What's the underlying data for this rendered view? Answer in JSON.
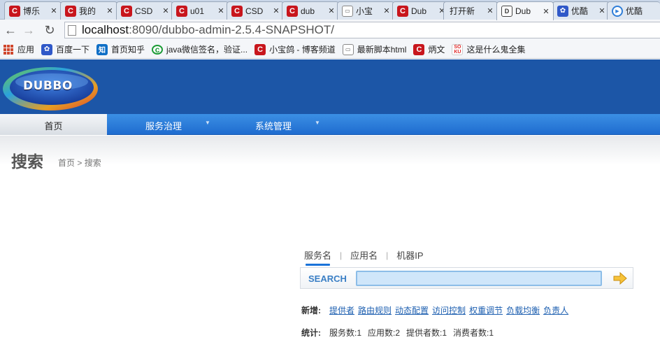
{
  "tabs": [
    {
      "title": "博乐",
      "icon": "c",
      "left": 0
    },
    {
      "title": "我的",
      "icon": "c"
    },
    {
      "title": "CSD",
      "icon": "c"
    },
    {
      "title": "u01",
      "icon": "c"
    },
    {
      "title": "CSD",
      "icon": "c"
    },
    {
      "title": "dub",
      "icon": "c"
    },
    {
      "title": "小宝",
      "icon": "doc"
    },
    {
      "title": "Dub",
      "icon": "c"
    },
    {
      "title": "打开新",
      "icon": "none"
    },
    {
      "title": "Dub",
      "icon": "dubbo"
    },
    {
      "title": "优酷",
      "icon": "paw"
    },
    {
      "title": "优酷",
      "icon": "play"
    }
  ],
  "toolbar": {
    "back": "←",
    "forward": "→",
    "reload": "↻",
    "url_host": "localhost",
    "url_rest": ":8090/dubbo-admin-2.5.4-SNAPSHOT/"
  },
  "bookmarks": [
    {
      "label": "应用",
      "icon": "apps"
    },
    {
      "label": "百度一下",
      "icon": "paw"
    },
    {
      "label": "首页知乎",
      "icon": "zhi"
    },
    {
      "label": "java微信签名，验证...",
      "icon": "g"
    },
    {
      "label": "小宝鸽 - 博客频道",
      "icon": "c"
    },
    {
      "label": "最新脚本html",
      "icon": "doc"
    },
    {
      "label": "炳文",
      "icon": "c"
    },
    {
      "label": "这是什么鬼全集",
      "icon": "soku"
    }
  ],
  "header": {
    "logo_text": "DUBBO"
  },
  "nav": {
    "home": "首页",
    "services": "服务治理",
    "system": "系统管理"
  },
  "page": {
    "title": "搜索",
    "crumb_home": "首页",
    "crumb_sep": ">",
    "crumb_current": "搜索"
  },
  "search": {
    "tabs": [
      "服务名",
      "应用名",
      "机器IP"
    ],
    "label": "SEARCH",
    "value": "",
    "placeholder": ""
  },
  "create": {
    "label": "新增:",
    "links": [
      "提供者",
      "路由规则",
      "动态配置",
      "访问控制",
      "权重调节",
      "负载均衡",
      "负责人"
    ]
  },
  "stats": {
    "label": "统计:",
    "items": [
      "服务数:1",
      "应用数:2",
      "提供者数:1",
      "消费者数:1"
    ]
  },
  "colors": {
    "header_blue": "#1c56a7",
    "nav_blue": "#2b7ddb",
    "link_blue": "#1d5fb0",
    "search_label": "#3a7fc5"
  }
}
